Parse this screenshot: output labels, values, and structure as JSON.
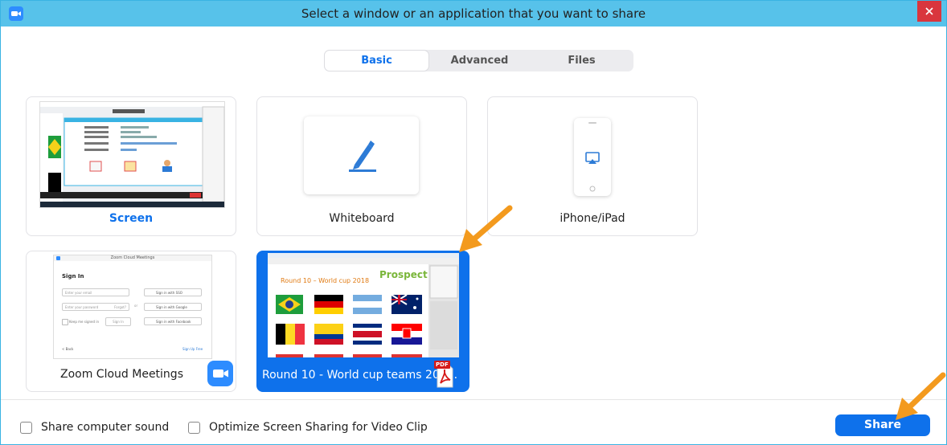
{
  "window": {
    "title": "Select a window or an application that you want to share",
    "close_symbol": "×"
  },
  "tabs": [
    {
      "label": "Basic",
      "active": true
    },
    {
      "label": "Advanced",
      "active": false
    },
    {
      "label": "Files",
      "active": false
    }
  ],
  "cards": {
    "screen": {
      "label": "Screen"
    },
    "whiteboard": {
      "label": "Whiteboard"
    },
    "iphone": {
      "label": "iPhone/iPad"
    },
    "zoom_app": {
      "label": "Zoom Cloud Meetings",
      "thumb_title": "Zoom Cloud Meetings",
      "sign_in": "Sign In",
      "email_placeholder": "Enter your email",
      "password_placeholder": "Enter your password",
      "forgot": "Forgot?",
      "or": "or",
      "keep_signed_in": "Keep me signed in",
      "sign_in_button": "Sign In",
      "sso": "Sign in with SSO",
      "google": "Sign in with Google",
      "facebook": "Sign in with Facebook",
      "back": "< Back",
      "sign_up": "Sign Up Free"
    },
    "pdf": {
      "label": "Round 10 - World cup teams 201...",
      "doc_title": "Round 10 – World cup 2018",
      "brand": "Prospect",
      "badge": "PDF"
    }
  },
  "footer": {
    "share_sound": "Share computer sound",
    "optimize": "Optimize Screen Sharing for Video Clip",
    "share_button": "Share"
  },
  "colors": {
    "titlebar": "#57c2ea",
    "accent": "#0e71eb",
    "close": "#d9363e",
    "annotation_arrow": "#f39a1e"
  }
}
